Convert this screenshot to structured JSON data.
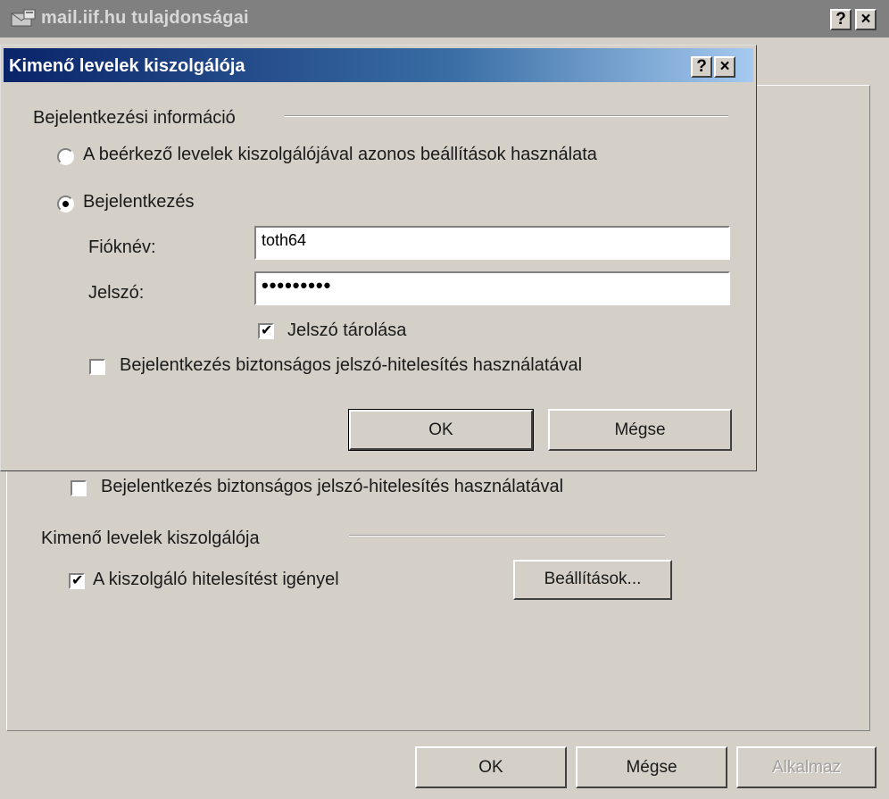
{
  "parent": {
    "title": "mail.iif.hu tulajdonságai",
    "icons": {
      "window": "mail-server-icon",
      "help": "?",
      "close": "×"
    },
    "secure_auth_label": "Bejelentkezés biztonságos jelszó-hitelesítés használatával",
    "secure_auth_checked": false,
    "outgoing_group_label": "Kimenő levelek kiszolgálója",
    "requires_auth_label": "A kiszolgáló hitelesítést igényel",
    "requires_auth_checked": true,
    "settings_button": "Beállítások...",
    "ok_button": "OK",
    "cancel_button": "Mégse",
    "apply_button": "Alkalmaz"
  },
  "dialog": {
    "title": "Kimenő levelek kiszolgálója",
    "help": "?",
    "close": "×",
    "group_label": "Bejelentkezési információ",
    "radio_same": "A beérkező levelek kiszolgálójával azonos beállítások használata",
    "radio_login": "Bejelentkezés",
    "selected_radio": "radio_login",
    "account_label": "Fióknév:",
    "account_value": "toth64",
    "password_label": "Jelszó:",
    "password_value": "•••••••••",
    "remember_password_label": "Jelszó tárolása",
    "remember_password_checked": true,
    "spa_label": "Bejelentkezés biztonságos jelszó-hitelesítés használatával",
    "spa_checked": false,
    "ok_button": "OK",
    "cancel_button": "Mégse"
  },
  "colors": {
    "active_title_start": "#0a246a",
    "active_title_end": "#a6caf0",
    "inactive_title": "#808080",
    "face": "#d4d0c8"
  }
}
